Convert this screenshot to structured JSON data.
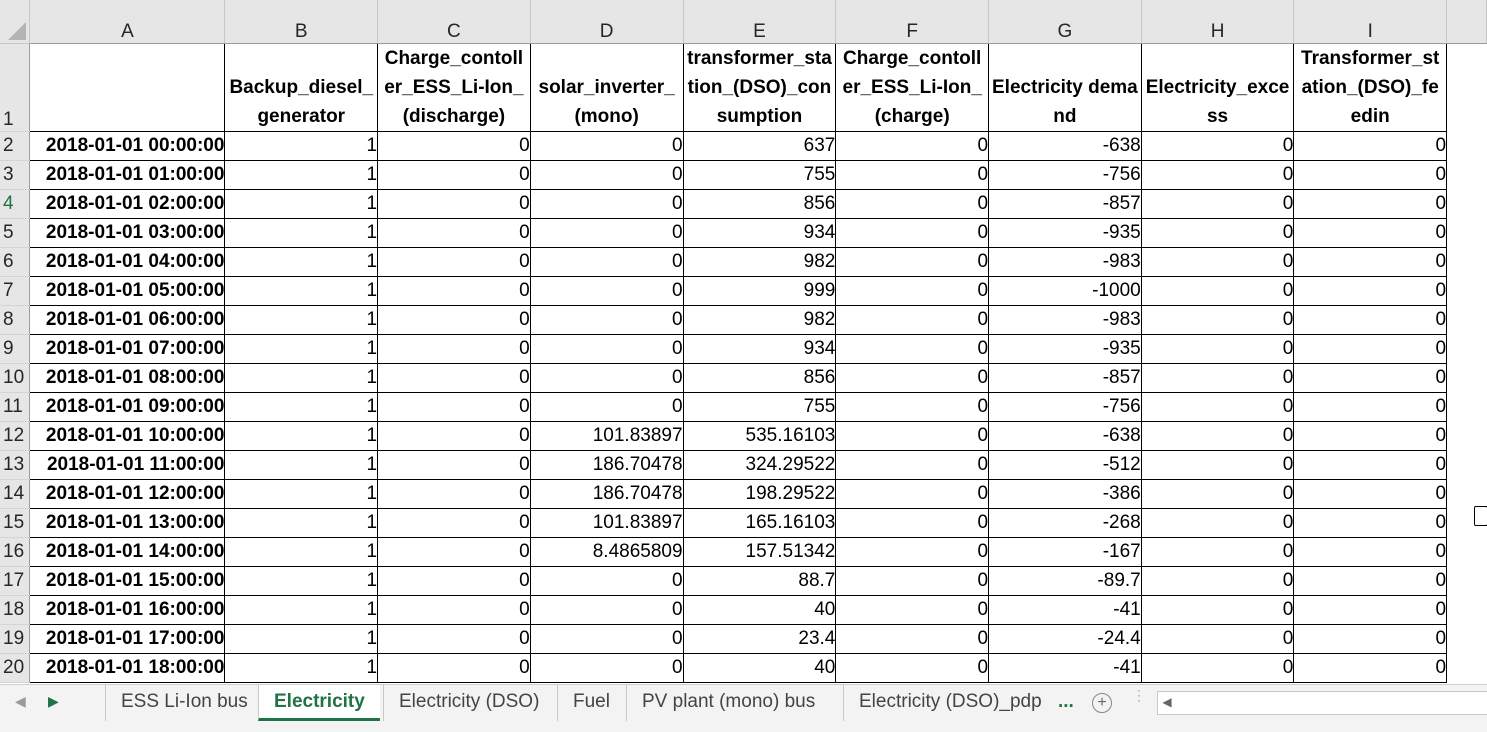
{
  "columns": [
    "A",
    "B",
    "C",
    "D",
    "E",
    "F",
    "G",
    "H",
    "I"
  ],
  "header_row_number": "1",
  "headers": [
    "",
    "Backup_diesel_generator",
    "Charge_contoller_ESS_Li-Ion_(discharge)",
    "solar_inverter_(mono)",
    "transformer_station_(DSO)_consumption",
    "Charge_contoller_ESS_Li-Ion_(charge)",
    "Electricity demand",
    "Electricity_excess",
    "Transformer_station_(DSO)_feedin"
  ],
  "rows": [
    {
      "num": "2",
      "cells": [
        "2018-01-01 00:00:00",
        "1",
        "0",
        "0",
        "637",
        "0",
        "-638",
        "0",
        "0"
      ]
    },
    {
      "num": "3",
      "cells": [
        "2018-01-01 01:00:00",
        "1",
        "0",
        "0",
        "755",
        "0",
        "-756",
        "0",
        "0"
      ]
    },
    {
      "num": "4",
      "cells": [
        "2018-01-01 02:00:00",
        "1",
        "0",
        "0",
        "856",
        "0",
        "-857",
        "0",
        "0"
      ]
    },
    {
      "num": "5",
      "cells": [
        "2018-01-01 03:00:00",
        "1",
        "0",
        "0",
        "934",
        "0",
        "-935",
        "0",
        "0"
      ]
    },
    {
      "num": "6",
      "cells": [
        "2018-01-01 04:00:00",
        "1",
        "0",
        "0",
        "982",
        "0",
        "-983",
        "0",
        "0"
      ]
    },
    {
      "num": "7",
      "cells": [
        "2018-01-01 05:00:00",
        "1",
        "0",
        "0",
        "999",
        "0",
        "-1000",
        "0",
        "0"
      ]
    },
    {
      "num": "8",
      "cells": [
        "2018-01-01 06:00:00",
        "1",
        "0",
        "0",
        "982",
        "0",
        "-983",
        "0",
        "0"
      ]
    },
    {
      "num": "9",
      "cells": [
        "2018-01-01 07:00:00",
        "1",
        "0",
        "0",
        "934",
        "0",
        "-935",
        "0",
        "0"
      ]
    },
    {
      "num": "10",
      "cells": [
        "2018-01-01 08:00:00",
        "1",
        "0",
        "0",
        "856",
        "0",
        "-857",
        "0",
        "0"
      ]
    },
    {
      "num": "11",
      "cells": [
        "2018-01-01 09:00:00",
        "1",
        "0",
        "0",
        "755",
        "0",
        "-756",
        "0",
        "0"
      ]
    },
    {
      "num": "12",
      "cells": [
        "2018-01-01 10:00:00",
        "1",
        "0",
        "101.83897",
        "535.16103",
        "0",
        "-638",
        "0",
        "0"
      ]
    },
    {
      "num": "13",
      "cells": [
        "2018-01-01 11:00:00",
        "1",
        "0",
        "186.70478",
        "324.29522",
        "0",
        "-512",
        "0",
        "0"
      ]
    },
    {
      "num": "14",
      "cells": [
        "2018-01-01 12:00:00",
        "1",
        "0",
        "186.70478",
        "198.29522",
        "0",
        "-386",
        "0",
        "0"
      ]
    },
    {
      "num": "15",
      "cells": [
        "2018-01-01 13:00:00",
        "1",
        "0",
        "101.83897",
        "165.16103",
        "0",
        "-268",
        "0",
        "0"
      ]
    },
    {
      "num": "16",
      "cells": [
        "2018-01-01 14:00:00",
        "1",
        "0",
        "8.4865809",
        "157.51342",
        "0",
        "-167",
        "0",
        "0"
      ]
    },
    {
      "num": "17",
      "cells": [
        "2018-01-01 15:00:00",
        "1",
        "0",
        "0",
        "88.7",
        "0",
        "-89.7",
        "0",
        "0"
      ]
    },
    {
      "num": "18",
      "cells": [
        "2018-01-01 16:00:00",
        "1",
        "0",
        "0",
        "40",
        "0",
        "-41",
        "0",
        "0"
      ]
    },
    {
      "num": "19",
      "cells": [
        "2018-01-01 17:00:00",
        "1",
        "0",
        "0",
        "23.4",
        "0",
        "-24.4",
        "0",
        "0"
      ]
    },
    {
      "num": "20",
      "cells": [
        "2018-01-01 18:00:00",
        "1",
        "0",
        "0",
        "40",
        "0",
        "-41",
        "0",
        "0"
      ]
    }
  ],
  "selected_row": "4",
  "tabs": {
    "t0": "ESS Li-Ion bus",
    "t1": "Electricity",
    "t2": "Electricity (DSO)",
    "t3": "Fuel",
    "t4": "PV plant (mono) bus",
    "t5": "Electricity (DSO)_pdp",
    "more": "...",
    "add": "+"
  },
  "icons": {
    "nav_left": "triangle-left-icon",
    "nav_right": "triangle-right-icon",
    "add_sheet": "plus-circle-icon",
    "scroll_left": "scroll-left-icon"
  },
  "colors": {
    "accent": "#217346"
  }
}
